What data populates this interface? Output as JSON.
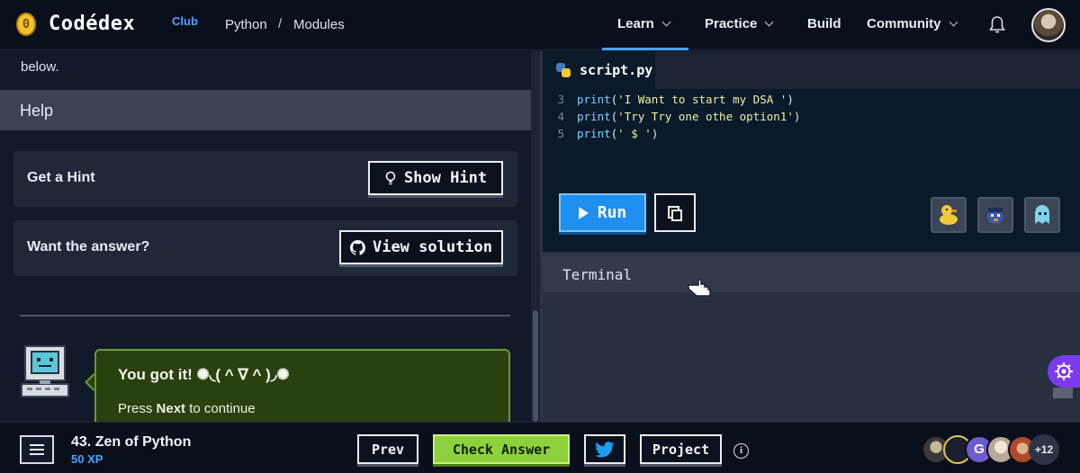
{
  "brand": {
    "coin": "0",
    "name": "Codédex",
    "club": "Club"
  },
  "breadcrumb": {
    "course": "Python",
    "separator": "/",
    "section": "Modules"
  },
  "nav": {
    "learn": "Learn",
    "practice": "Practice",
    "build": "Build",
    "community": "Community"
  },
  "instructions": {
    "fragment": "below."
  },
  "help": {
    "title": "Help",
    "hint_label": "Get a Hint",
    "hint_button": "Show Hint",
    "answer_label": "Want the answer?",
    "solution_button": "View solution"
  },
  "feedback": {
    "title": "You got it! ✺◟( ^ ∇ ^ )◞✺",
    "press": "Press",
    "next": "Next",
    "continue": "to continue"
  },
  "editor": {
    "tab_name": "script.py",
    "lines": [
      {
        "num": "3",
        "fn": "print",
        "open": "(",
        "str": "'I Want to start my DSA '",
        "close": ")"
      },
      {
        "num": "4",
        "fn": "print",
        "open": "(",
        "str": "'Try Try one othe option1'",
        "close": ")"
      },
      {
        "num": "5",
        "fn": "print",
        "open": "(",
        "str": "' $ '",
        "close": ")"
      }
    ],
    "run_label": "Run"
  },
  "terminal": {
    "title": "Terminal"
  },
  "bottom": {
    "lesson_title": "43. Zen of Python",
    "xp": "50 XP",
    "prev": "Prev",
    "check": "Check Answer",
    "project": "Project",
    "info": "i",
    "avatar_letter": "G",
    "more_count": "+12"
  },
  "colors": {
    "accent_blue": "#1f8ff0",
    "check_green": "#8fd13c",
    "success_bg": "#28410f",
    "fab_purple": "#7c3aed"
  },
  "icons": [
    "bell-icon",
    "bulb-icon",
    "github-icon",
    "play-icon",
    "copy-icon",
    "python-icon",
    "menu-icon",
    "twitter-icon",
    "info-icon",
    "gear-icon",
    "pointer-hand-icon"
  ]
}
